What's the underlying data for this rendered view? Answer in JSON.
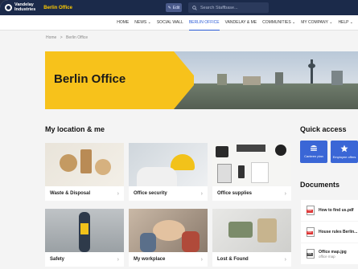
{
  "header": {
    "logo_line1": "Vandelay",
    "logo_line2": "Industries",
    "site_name": "Berlin Office",
    "edit_label": "Edit",
    "search_placeholder": "Search Staffbase..."
  },
  "nav": {
    "items": [
      {
        "label": "HOME"
      },
      {
        "label": "NEWS ⌄"
      },
      {
        "label": "SOCIAL WALL"
      },
      {
        "label": "BERLIN OFFICE",
        "active": true
      },
      {
        "label": "VANDELAY & ME"
      },
      {
        "label": "COMMUNITIES ⌄"
      },
      {
        "label": "MY COMPANY ⌄"
      },
      {
        "label": "HELP ⌄"
      }
    ]
  },
  "breadcrumb": {
    "home": "Home",
    "sep": ">",
    "current": "Berlin Office"
  },
  "hero": {
    "title": "Berlin Office",
    "accent": "#f7c21b"
  },
  "location": {
    "title": "My location & me",
    "tiles": [
      {
        "label": "Waste & Disposal"
      },
      {
        "label": "Office security"
      },
      {
        "label": "Office supplies"
      },
      {
        "label": "Safety"
      },
      {
        "label": "My workplace"
      },
      {
        "label": "Lost & Found"
      }
    ]
  },
  "quick_access": {
    "title": "Quick access",
    "items": [
      {
        "label": "Canteen plan",
        "icon": "burger-icon"
      },
      {
        "label": "Employee offers",
        "icon": "star-icon"
      }
    ]
  },
  "documents": {
    "title": "Documents",
    "items": [
      {
        "name": "How to find us.pdf",
        "sub": "",
        "type": "PDF"
      },
      {
        "name": "House rules Berlin...",
        "sub": "",
        "type": "PDF"
      },
      {
        "name": "Office map.jpg",
        "sub": "office map",
        "type": "IMG"
      }
    ]
  },
  "colors": {
    "nav_bg": "#1b2a4a",
    "accent_blue": "#3a66d6",
    "brand_yellow": "#ffcc00"
  }
}
